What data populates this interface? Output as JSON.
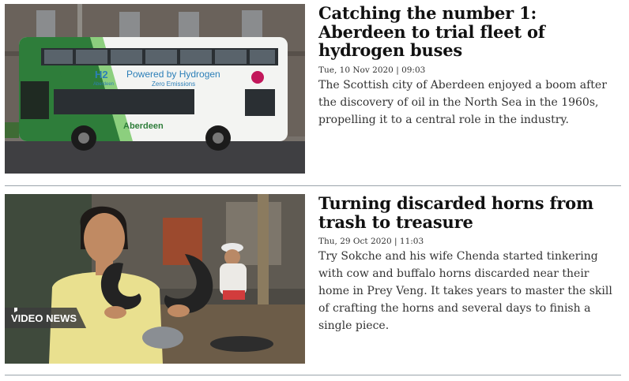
{
  "articles": [
    {
      "headline": "Catching the number 1: Aberdeen to trial fleet of hydrogen buses",
      "date": "Tue, 10 Nov 2020 | 09:03",
      "summary": "The Scottish city of Aberdeen enjoyed a boom after the discovery of oil in the North Sea in the 1960s, propelling it to a central role in the industry.",
      "image": {
        "bus_slogan_1": "Powered by Hydrogen",
        "bus_slogan_2": "Zero Emissions",
        "bus_brand": "Aberdeen",
        "bus_logo": "H2",
        "bus_logo_sub": "Aberdeen"
      }
    },
    {
      "headline": "Turning discarded horns from trash to treasure",
      "date": "Thu, 29 Oct 2020 | 11:03",
      "summary": "Try Sokche and his wife Chenda started tinkering with cow and buffalo horns discarded near their home in Prey Veng. It takes years to master the skill of crafting the horns and several days to finish a single piece.",
      "badge": "VIDEO NEWS"
    }
  ],
  "colors": {
    "bus_green": "#2e7d3a",
    "bus_white": "#f3f4f2",
    "headline": "#111111",
    "divider": "#9aa3ab"
  }
}
